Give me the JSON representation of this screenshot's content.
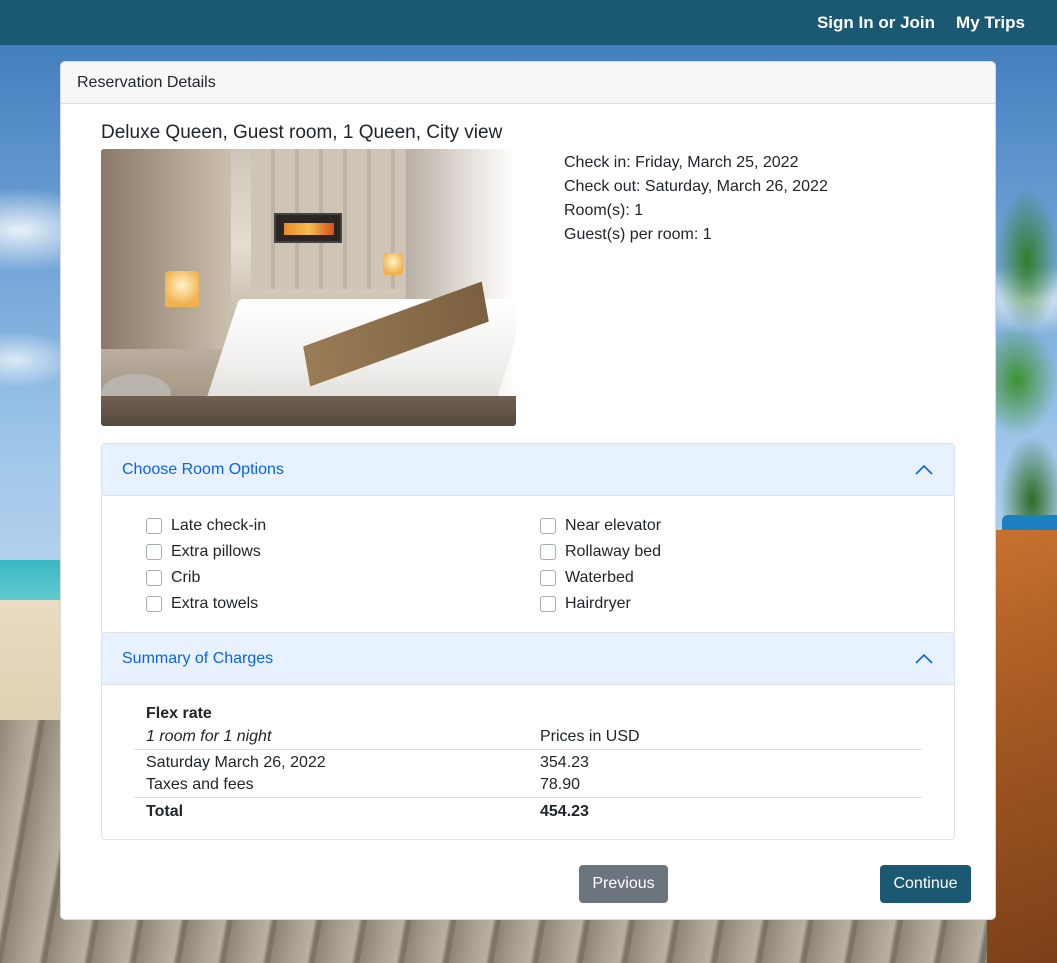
{
  "nav": {
    "sign_in": "Sign In or Join",
    "my_trips": "My Trips"
  },
  "card": {
    "header": "Reservation Details"
  },
  "room": {
    "title": "Deluxe Queen, Guest room, 1 Queen, City view",
    "check_in": "Check in: Friday, March 25, 2022",
    "check_out": "Check out: Saturday, March 26, 2022",
    "rooms": "Room(s): 1",
    "guests": "Guest(s) per room: 1"
  },
  "options_section": {
    "title": "Choose Room Options",
    "items": [
      {
        "label": "Late check-in",
        "checked": false
      },
      {
        "label": "Near elevator",
        "checked": false
      },
      {
        "label": "Extra pillows",
        "checked": false
      },
      {
        "label": "Rollaway bed",
        "checked": false
      },
      {
        "label": "Crib",
        "checked": false
      },
      {
        "label": "Waterbed",
        "checked": false
      },
      {
        "label": "Extra towels",
        "checked": false
      },
      {
        "label": "Hairdryer",
        "checked": false
      }
    ]
  },
  "charges_section": {
    "title": "Summary of Charges",
    "rate_name": "Flex rate",
    "rate_desc": "1 room for 1 night",
    "currency_note": "Prices in USD",
    "rows": [
      {
        "label": "Saturday March 26, 2022",
        "amount": "354.23"
      },
      {
        "label": "Taxes and fees",
        "amount": "78.90"
      }
    ],
    "total_label": "Total",
    "total_amount": "454.23"
  },
  "buttons": {
    "previous": "Previous",
    "continue": "Continue"
  },
  "colors": {
    "navbar": "#1b5872",
    "accordion_header_bg": "#e7f1ff",
    "accordion_header_text": "#0c63e4",
    "btn_previous": "#6c757d",
    "btn_continue": "#1b5872"
  },
  "icons": {
    "accordion_toggle": "chevron-up-icon",
    "checkbox": "checkbox-unchecked"
  }
}
